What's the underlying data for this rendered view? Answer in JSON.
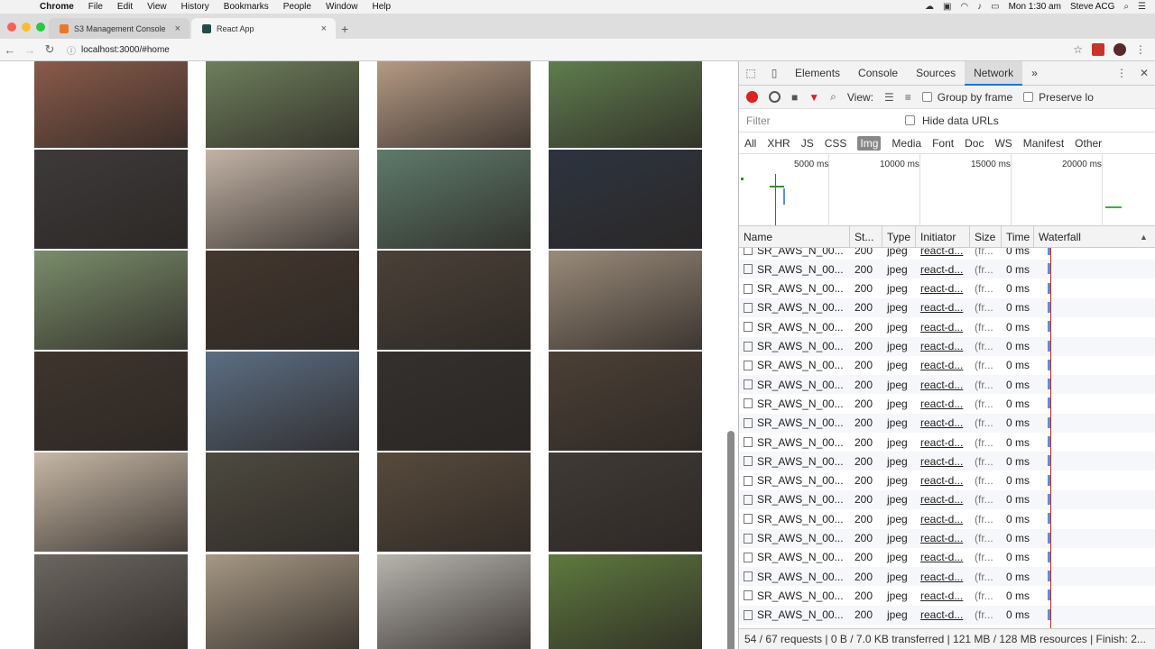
{
  "menubar": {
    "app": "Chrome",
    "items": [
      "File",
      "Edit",
      "View",
      "History",
      "Bookmarks",
      "People",
      "Window",
      "Help"
    ],
    "clock": "Mon 1:30 am",
    "user": "Steve ACG"
  },
  "tabs": [
    {
      "label": "S3 Management Console"
    },
    {
      "label": "React App"
    }
  ],
  "address": {
    "url": "localhost:3000/#home"
  },
  "photos": {
    "colors": [
      "#8a5b4a",
      "#6e7f5c",
      "#b59a84",
      "#5f7d4e",
      "#3d3a3a",
      "#c2b3a6",
      "#5e7b6a",
      "#2d3440",
      "#7a8d6b",
      "#43372e",
      "#4a4138",
      "#9a8b7a",
      "#3e352d",
      "#5c6e84",
      "#33302d",
      "#4b4036",
      "#c7b8a6",
      "#4d4a40",
      "#574a3c",
      "#3f3a36",
      "#6b6660",
      "#a69884",
      "#b8b4ae",
      "#5e7a3e"
    ]
  },
  "devtools": {
    "tabs": [
      "Elements",
      "Console",
      "Sources",
      "Network"
    ],
    "more": "»",
    "view_label": "View:",
    "group_by_frame": "Group by frame",
    "preserve_log": "Preserve lo",
    "filter_placeholder": "Filter",
    "hide_data_urls": "Hide data URLs",
    "type_filters": [
      "All",
      "XHR",
      "JS",
      "CSS",
      "Img",
      "Media",
      "Font",
      "Doc",
      "WS",
      "Manifest",
      "Other"
    ],
    "timeline_ticks": [
      "5000 ms",
      "10000 ms",
      "15000 ms",
      "20000 ms"
    ],
    "columns": [
      "Name",
      "St...",
      "Type",
      "Initiator",
      "Size",
      "Time",
      "Waterfall"
    ],
    "sort_arrow": "▲",
    "rows": [
      {
        "name": "SR_AWS_N_00...",
        "status": "200",
        "type": "jpeg",
        "initiator": "react-d...",
        "size": "(fr...",
        "time": "0 ms"
      },
      {
        "name": "SR_AWS_N_00...",
        "status": "200",
        "type": "jpeg",
        "initiator": "react-d...",
        "size": "(fr...",
        "time": "0 ms"
      },
      {
        "name": "SR_AWS_N_00...",
        "status": "200",
        "type": "jpeg",
        "initiator": "react-d...",
        "size": "(fr...",
        "time": "0 ms"
      },
      {
        "name": "SR_AWS_N_00...",
        "status": "200",
        "type": "jpeg",
        "initiator": "react-d...",
        "size": "(fr...",
        "time": "0 ms"
      },
      {
        "name": "SR_AWS_N_00...",
        "status": "200",
        "type": "jpeg",
        "initiator": "react-d...",
        "size": "(fr...",
        "time": "0 ms"
      },
      {
        "name": "SR_AWS_N_00...",
        "status": "200",
        "type": "jpeg",
        "initiator": "react-d...",
        "size": "(fr...",
        "time": "0 ms"
      },
      {
        "name": "SR_AWS_N_00...",
        "status": "200",
        "type": "jpeg",
        "initiator": "react-d...",
        "size": "(fr...",
        "time": "0 ms"
      },
      {
        "name": "SR_AWS_N_00...",
        "status": "200",
        "type": "jpeg",
        "initiator": "react-d...",
        "size": "(fr...",
        "time": "0 ms"
      },
      {
        "name": "SR_AWS_N_00...",
        "status": "200",
        "type": "jpeg",
        "initiator": "react-d...",
        "size": "(fr...",
        "time": "0 ms"
      },
      {
        "name": "SR_AWS_N_00...",
        "status": "200",
        "type": "jpeg",
        "initiator": "react-d...",
        "size": "(fr...",
        "time": "0 ms"
      },
      {
        "name": "SR_AWS_N_00...",
        "status": "200",
        "type": "jpeg",
        "initiator": "react-d...",
        "size": "(fr...",
        "time": "0 ms"
      },
      {
        "name": "SR_AWS_N_00...",
        "status": "200",
        "type": "jpeg",
        "initiator": "react-d...",
        "size": "(fr...",
        "time": "0 ms"
      },
      {
        "name": "SR_AWS_N_00...",
        "status": "200",
        "type": "jpeg",
        "initiator": "react-d...",
        "size": "(fr...",
        "time": "0 ms"
      },
      {
        "name": "SR_AWS_N_00...",
        "status": "200",
        "type": "jpeg",
        "initiator": "react-d...",
        "size": "(fr...",
        "time": "0 ms"
      },
      {
        "name": "SR_AWS_N_00...",
        "status": "200",
        "type": "jpeg",
        "initiator": "react-d...",
        "size": "(fr...",
        "time": "0 ms"
      },
      {
        "name": "SR_AWS_N_00...",
        "status": "200",
        "type": "jpeg",
        "initiator": "react-d...",
        "size": "(fr...",
        "time": "0 ms"
      },
      {
        "name": "SR_AWS_N_00...",
        "status": "200",
        "type": "jpeg",
        "initiator": "react-d...",
        "size": "(fr...",
        "time": "0 ms"
      },
      {
        "name": "SR_AWS_N_00...",
        "status": "200",
        "type": "jpeg",
        "initiator": "react-d...",
        "size": "(fr...",
        "time": "0 ms"
      },
      {
        "name": "SR_AWS_N_00...",
        "status": "200",
        "type": "jpeg",
        "initiator": "react-d...",
        "size": "(fr...",
        "time": "0 ms"
      },
      {
        "name": "SR_AWS_N_00...",
        "status": "200",
        "type": "jpeg",
        "initiator": "react-d...",
        "size": "(fr...",
        "time": "0 ms"
      }
    ],
    "status_text": "54 / 67 requests | 0 B / 7.0 KB transferred | 121 MB / 128 MB resources | Finish: 2..."
  },
  "colors": {
    "accent": "#1a73e8",
    "record": "#e02020"
  }
}
